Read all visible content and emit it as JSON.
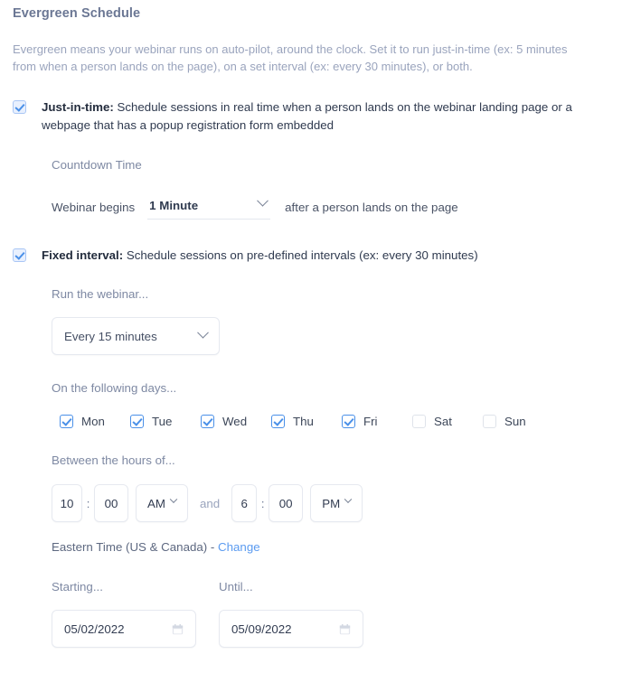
{
  "page": {
    "title": "Evergreen Schedule",
    "intro": "Evergreen means your webinar runs on auto-pilot, around the clock. Set it to run just-in-time (ex: 5 minutes from when a person lands on the page), on a set interval (ex: every 30 minutes), or both."
  },
  "just_in_time": {
    "checked": true,
    "label_bold": "Just-in-time:",
    "label_rest": " Schedule sessions in real time when a person lands on the webinar landing page or a webpage that has a popup registration form embedded",
    "countdown_heading": "Countdown Time",
    "begins_prefix": "Webinar begins",
    "duration_value": "1 Minute",
    "begins_suffix": "after a person lands on the page"
  },
  "fixed_interval": {
    "checked": true,
    "label_bold": "Fixed interval:",
    "label_rest": " Schedule sessions on pre-defined intervals (ex: every 30 minutes)",
    "run_heading": "Run the webinar...",
    "interval_value": "Every 15 minutes",
    "days_heading": "On the following days...",
    "days": [
      {
        "label": "Mon",
        "checked": true
      },
      {
        "label": "Tue",
        "checked": true
      },
      {
        "label": "Wed",
        "checked": true
      },
      {
        "label": "Thu",
        "checked": true
      },
      {
        "label": "Fri",
        "checked": true
      },
      {
        "label": "Sat",
        "checked": false
      },
      {
        "label": "Sun",
        "checked": false
      }
    ],
    "hours_heading": "Between the hours of...",
    "start_hour": "10",
    "start_minute": "00",
    "start_meridiem": "AM",
    "and_text": "and",
    "end_hour": "6",
    "end_minute": "00",
    "end_meridiem": "PM",
    "timezone_text": "Eastern Time (US & Canada) -",
    "timezone_change_link": "Change",
    "starting_heading": "Starting...",
    "starting_date": "05/02/2022",
    "until_heading": "Until...",
    "until_date": "05/09/2022"
  },
  "colors": {
    "accent": "#4a90e8",
    "link": "#5b9bf0",
    "muted": "#9aa4bd",
    "text": "#3d4759",
    "border": "#e6e9f0"
  },
  "icons": {
    "chevron": "chevron-down-icon",
    "calendar": "calendar-icon",
    "check": "check-icon"
  }
}
